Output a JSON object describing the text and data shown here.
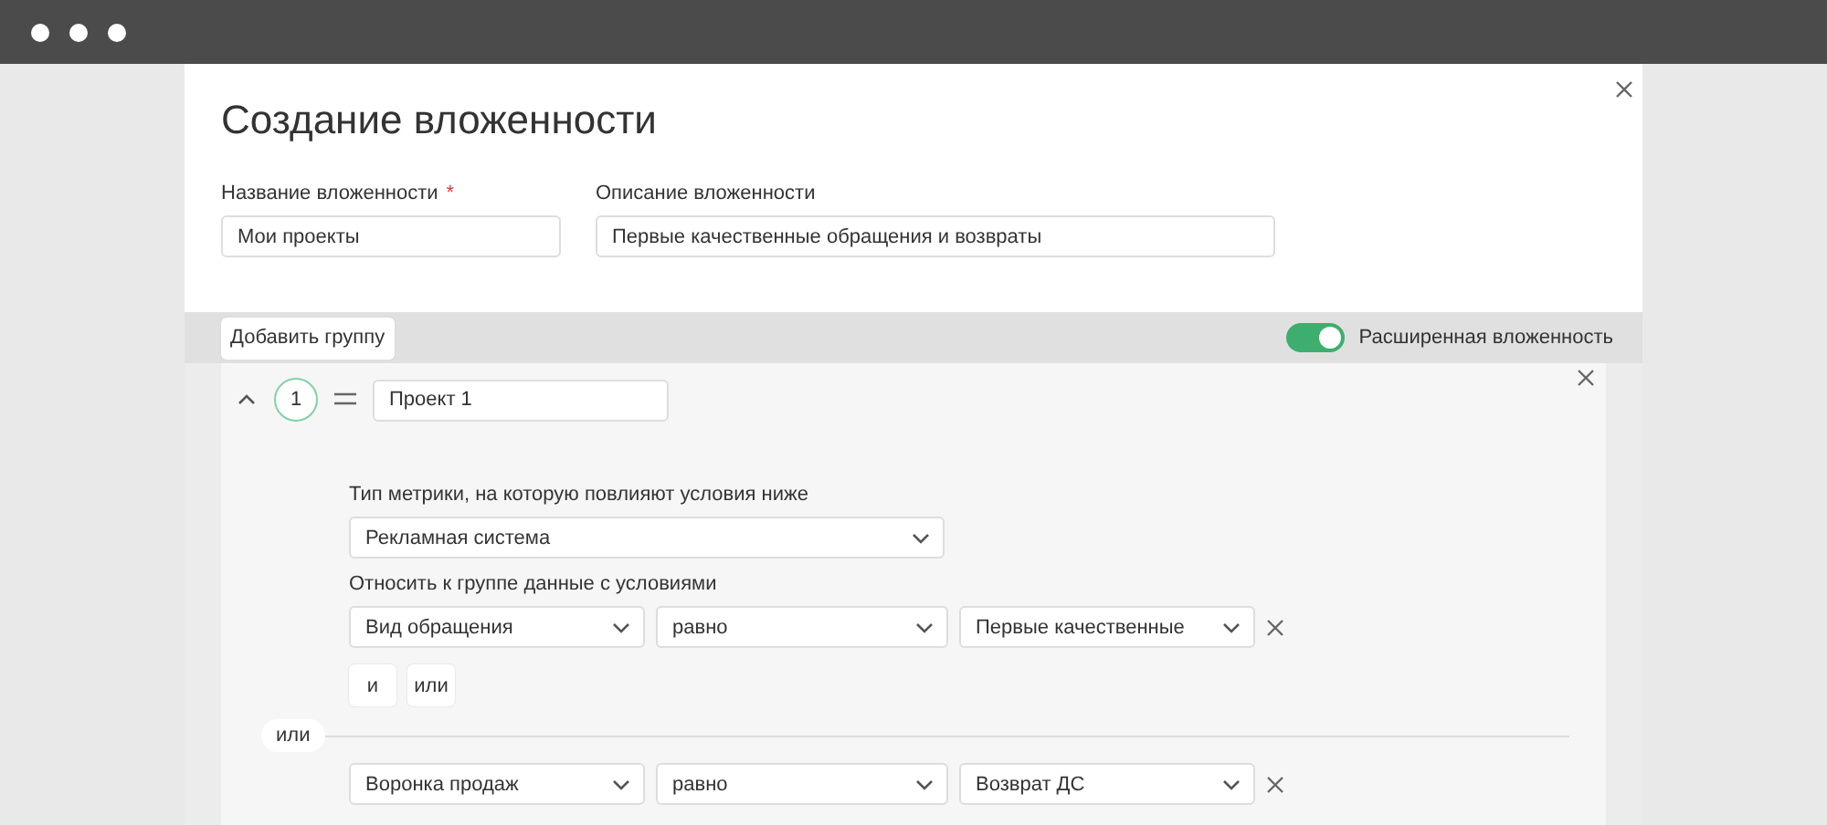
{
  "dialog": {
    "title": "Создание вложенности",
    "fields": [
      {
        "label": "Название вложенности",
        "required_mark": "*",
        "value": "Мои проекты"
      },
      {
        "label": "Описание вложенности",
        "value": "Первые качественные обращения и возвраты"
      }
    ],
    "toolbar": {
      "add_button": "Добавить группу",
      "toggle": {
        "label": "Расширенная вложенность",
        "on": true
      }
    },
    "groups": [
      {
        "number": "1",
        "expanded": true,
        "name": "Проект 1",
        "metric_label": "Тип метрики, на которую повлияют условия ниже",
        "metric_value": "Рекламная система",
        "conditions_label": "Относить к группе данные с условиями",
        "blocks": [
          {
            "conditions": [
              {
                "field": "Вид обращения",
                "operator": "равно",
                "value": "Первые качественные"
              }
            ],
            "buttons": [
              "и",
              "или"
            ]
          },
          {
            "joiner": "или",
            "conditions": [
              {
                "field": "Воронка продаж",
                "operator": "равно",
                "value": "Возврат ДС"
              }
            ]
          }
        ]
      }
    ]
  }
}
